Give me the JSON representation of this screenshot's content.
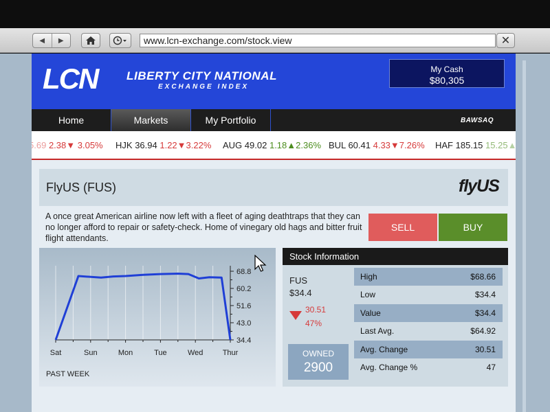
{
  "browser": {
    "url": "www.lcn-exchange.com/stock.view"
  },
  "header": {
    "logo_text": "LCN",
    "brand_line1": "LIBERTY CITY NATIONAL",
    "brand_line2": "EXCHANGE INDEX",
    "cash_label": "My Cash",
    "cash_value": "$80,305"
  },
  "nav": {
    "tabs": [
      {
        "label": "Home"
      },
      {
        "label": "Markets"
      },
      {
        "label": "My Portfolio"
      }
    ],
    "active_tab": "Markets",
    "partner_logo": "BAWSAQ"
  },
  "ticker": [
    {
      "symbol": "",
      "price": "5.69",
      "change": "2.38",
      "direction": "down",
      "percent": "3.05%"
    },
    {
      "symbol": "HJK",
      "price": "36.94",
      "change": "1.22",
      "direction": "down",
      "percent": "3.22%"
    },
    {
      "symbol": "AUG",
      "price": "49.02",
      "change": "1.18",
      "direction": "up",
      "percent": "2.36%"
    },
    {
      "symbol": "BUL",
      "price": "60.41",
      "change": "4.33",
      "direction": "down",
      "percent": "7.26%"
    },
    {
      "symbol": "HAF",
      "price": "185.15",
      "change": "15.25",
      "direction": "up",
      "percent": ""
    }
  ],
  "stock": {
    "title": "FlyUS (FUS)",
    "brand_logo": "flyUS",
    "description": "A once great American airline now left with a fleet of aging deathtraps that they can no longer afford to repair or safety-check. Home of vinegary old hags and bitter fruit flight attendants.",
    "sell_label": "SELL",
    "buy_label": "BUY"
  },
  "chart_data": {
    "type": "line",
    "title": "",
    "caption": "PAST WEEK",
    "x_labels": [
      "Sat",
      "Sun",
      "Mon",
      "Tue",
      "Wed",
      "Thur"
    ],
    "y_ticks": [
      "68.8",
      "60.2",
      "51.6",
      "43.0",
      "34.4"
    ],
    "ylim": [
      34.4,
      68.8
    ],
    "series": [
      {
        "color": "#1f3fd6",
        "points": [
          {
            "x": 0.0,
            "y": 34.4
          },
          {
            "x": 0.65,
            "y": 66.4
          },
          {
            "x": 1.3,
            "y": 65.6
          },
          {
            "x": 1.65,
            "y": 66.2
          },
          {
            "x": 2.0,
            "y": 66.4
          },
          {
            "x": 2.5,
            "y": 67.0
          },
          {
            "x": 3.0,
            "y": 67.4
          },
          {
            "x": 3.5,
            "y": 67.6
          },
          {
            "x": 3.8,
            "y": 67.4
          },
          {
            "x": 4.1,
            "y": 65.2
          },
          {
            "x": 4.4,
            "y": 65.8
          },
          {
            "x": 4.75,
            "y": 65.6
          },
          {
            "x": 5.0,
            "y": 34.4
          }
        ]
      }
    ],
    "grid": "vertical",
    "line_color": "#1f3fd6"
  },
  "info": {
    "heading": "Stock Information",
    "symbol": "FUS",
    "price": "$34.4",
    "change": "30.51",
    "change_percent": "47%",
    "owned_label": "OWNED",
    "owned_value": "2900",
    "rows": [
      {
        "key": "High",
        "value": "$68.66"
      },
      {
        "key": "Low",
        "value": "$34.4"
      },
      {
        "key": "Value",
        "value": "$34.4"
      },
      {
        "key": "Last Avg.",
        "value": "$64.92"
      },
      {
        "key": "Avg. Change",
        "value": "30.51"
      },
      {
        "key": "Avg. Change %",
        "value": "47"
      }
    ]
  },
  "colors": {
    "header_blue": "#2446d8",
    "sell_red": "#e05c5c",
    "buy_green": "#5a8e2a",
    "negative": "#d63a3a",
    "positive": "#4c8d1e"
  },
  "icons": {
    "back": "back-arrow-icon",
    "forward": "forward-arrow-icon",
    "home": "home-icon",
    "history": "clock-icon",
    "close": "close-icon",
    "cursor": "mouse-pointer-icon"
  }
}
